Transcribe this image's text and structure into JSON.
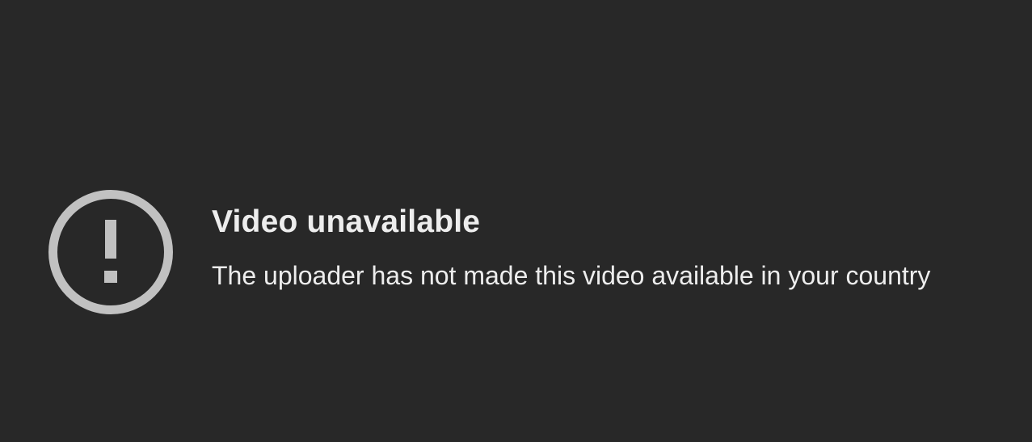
{
  "error": {
    "icon": "alert-circle-icon",
    "title": "Video unavailable",
    "message": "The uploader has not made this video available in your country"
  },
  "colors": {
    "background": "#282828",
    "icon": "#c1c1c1",
    "text": "#ededed"
  }
}
